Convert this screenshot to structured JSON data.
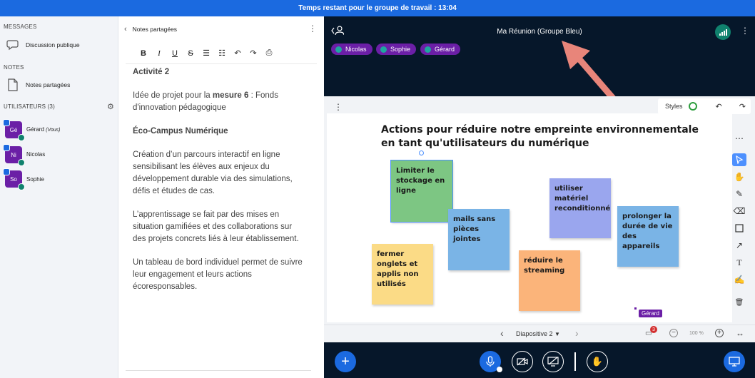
{
  "timer": "Temps restant pour le groupe de travail : 13:04",
  "sidebar": {
    "messages_heading": "MESSAGES",
    "public_chat": "Discussion publique",
    "notes_heading": "NOTES",
    "shared_notes": "Notes partagées",
    "users_heading": "UTILISATEURS (3)",
    "users": [
      {
        "initials": "Gé",
        "name": "Gérard",
        "you": "(Vous)"
      },
      {
        "initials": "Ni",
        "name": "Nicolas"
      },
      {
        "initials": "So",
        "name": "Sophie"
      }
    ]
  },
  "notes": {
    "title": "Notes partagées",
    "toolbar": [
      "B",
      "I",
      "U",
      "S",
      "ol",
      "ul",
      "undo",
      "redo",
      "export"
    ],
    "heading": "Activité 2",
    "p1_before": "Idée de projet pour la ",
    "p1_bold": "mesure 6",
    "p1_after": " : Fonds d'innovation pédagogique",
    "project": "Éco-Campus Numérique",
    "p2": "Création d’un parcours interactif en ligne sensibilisant les élèves aux enjeux du développement durable via des simulations, défis et études de cas.",
    "p3": "L’apprentissage se fait par des mises en situation gamifiées et des collaborations sur des projets concrets liés à leur établissement.",
    "p4": "Un tableau de bord individuel permet de suivre leur engagement et leurs actions écoresponsables."
  },
  "meeting": {
    "title": "Ma Réunion (Groupe Bleu)",
    "talkers": [
      "Nicolas",
      "Sophie",
      "Gérard"
    ]
  },
  "whiteboard": {
    "styles_label": "Styles",
    "title": "Actions pour réduire notre empreinte environnementale en tant qu'utilisateurs du numérique",
    "stickies": [
      {
        "text": "Limiter le stockage en ligne",
        "color": "#7dc683"
      },
      {
        "text": "mails sans pièces jointes",
        "color": "#7ab4e6"
      },
      {
        "text": "utiliser matériel reconditionné",
        "color": "#9aa6ee"
      },
      {
        "text": "prolonger la durée de vie des appareils",
        "color": "#7ab4e6"
      },
      {
        "text": "fermer onglets et applis non utilisés",
        "color": "#fbdb86"
      },
      {
        "text": "réduire le streaming",
        "color": "#fbb47a"
      }
    ],
    "cursor_label": "Gérard",
    "slide_label": "Diapositive 2",
    "zoom": "100 %",
    "notification_count": "3"
  },
  "colors": {
    "brand_blue": "#1b6ae0",
    "dark_bg": "#06172a",
    "purple": "#6b1fa6",
    "arrow": "#e8857a"
  }
}
